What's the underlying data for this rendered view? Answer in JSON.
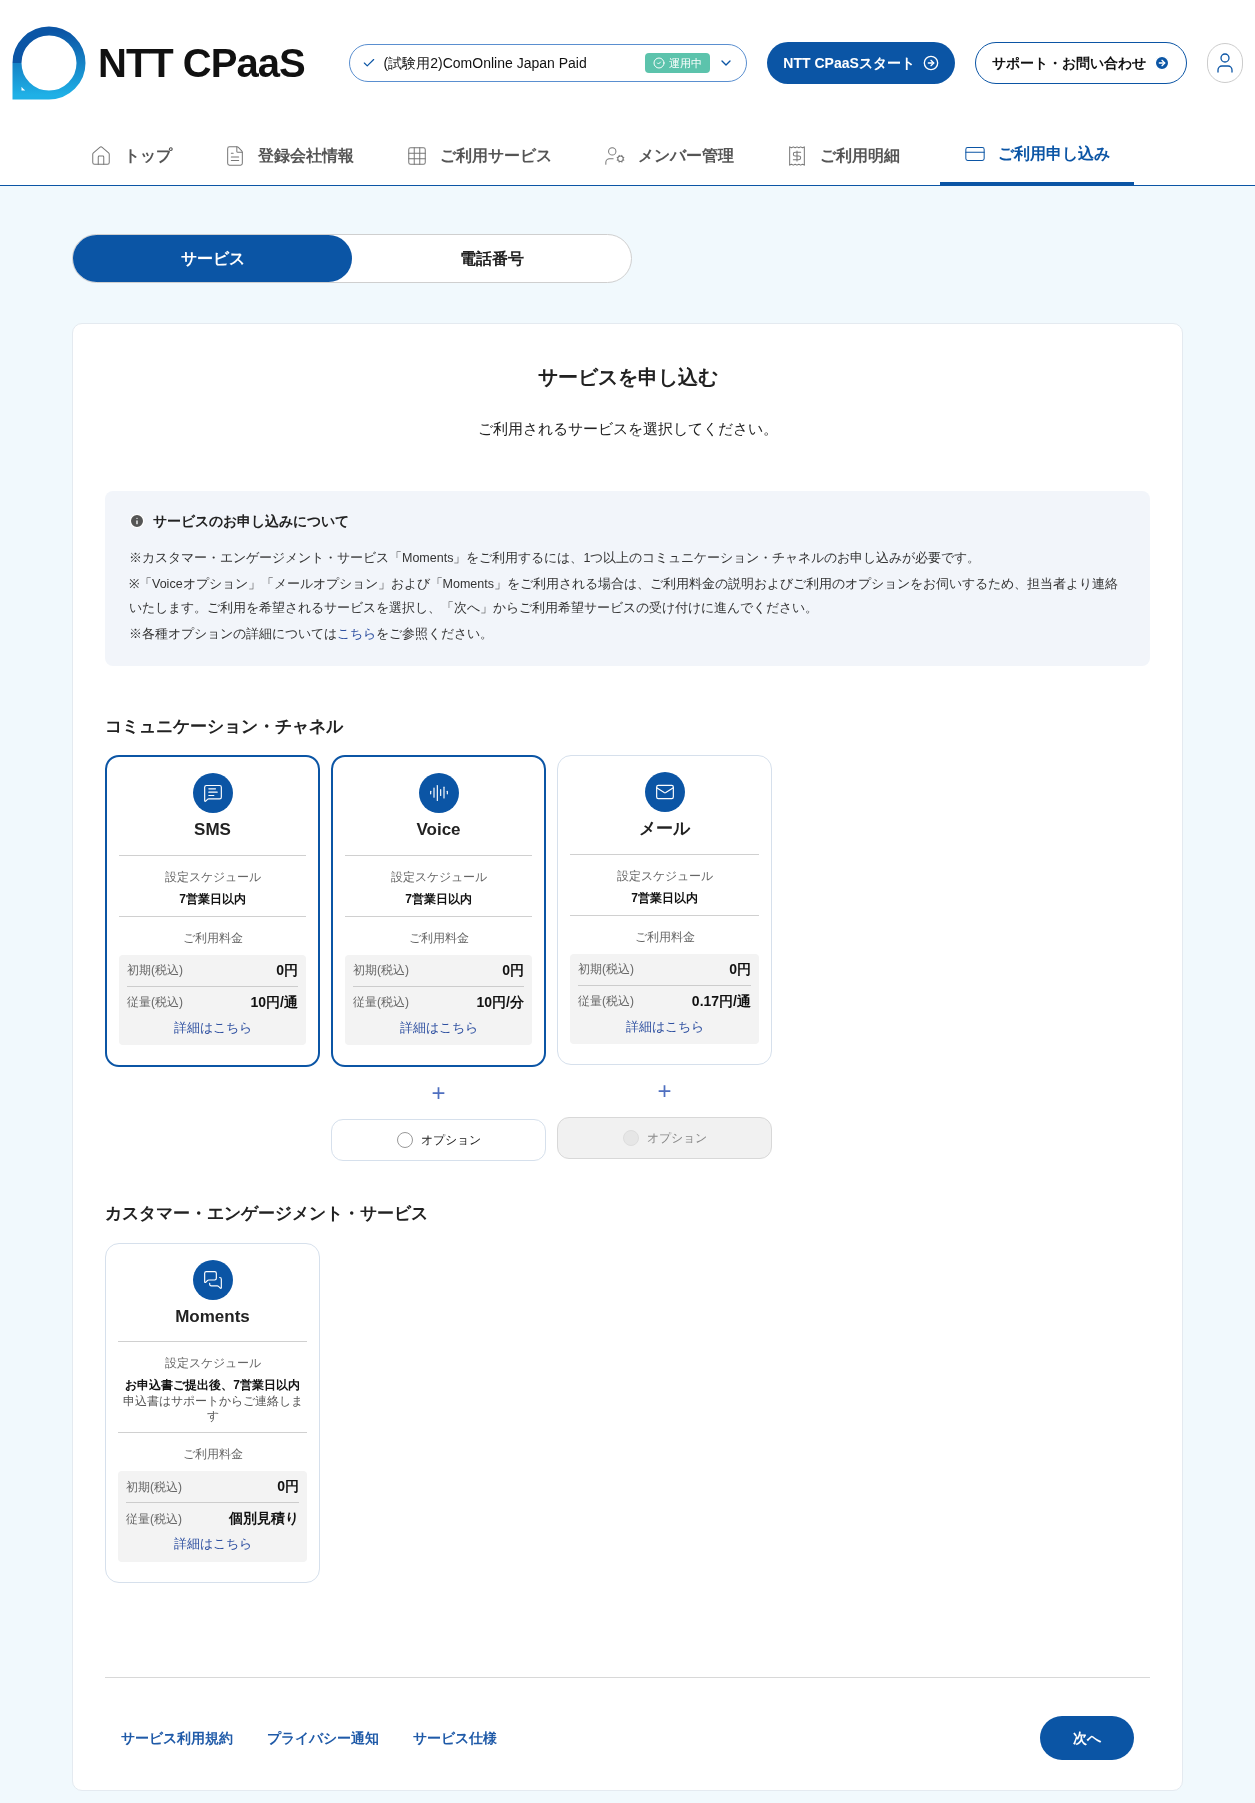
{
  "header": {
    "logo": "NTT CPaaS",
    "account": {
      "name": "(試験用2)ComOnline Japan Paid",
      "status": "運用中"
    },
    "buttons": [
      "NTT CPaaSスタート",
      "サポート・お問い合わせ"
    ]
  },
  "nav": [
    {
      "label": "トップ",
      "kind": "home",
      "selected": false
    },
    {
      "label": "登録会社情報",
      "kind": "doc",
      "selected": false
    },
    {
      "label": "ご利用サービス",
      "kind": "grid",
      "selected": false
    },
    {
      "label": "メンバー管理",
      "kind": "members",
      "selected": false
    },
    {
      "label": "ご利用明細",
      "kind": "bill",
      "selected": false
    },
    {
      "label": "ご利用申し込み",
      "kind": "apply",
      "selected": true
    }
  ],
  "tabs": [
    {
      "label": "サービス",
      "selected": true
    },
    {
      "label": "電話番号",
      "selected": false
    }
  ],
  "title": "サービスを申し込む",
  "subtitle": "ご利用されるサービスを選択してください。",
  "info": {
    "heading": "サービスのお申し込みについて",
    "notes": [
      "※カスタマー・エンゲージメント・サービス「Moments」をご利用するには、1つ以上のコミュニケーション・チャネルのお申し込みが必要です。",
      "※「Voiceオプション」「メールオプション」および「Moments」をご利用される場合は、ご利用料金の説明およびご利用のオプションをお伺いするため、担当者より連絡いたします。ご利用を希望されるサービスを選択し、「次へ」からご利用希望サービスの受け付けに進んでください。"
    ],
    "last_note": {
      "before": "※各種オプションの詳細については",
      "link": "こちら",
      "after": "をご参照ください。"
    }
  },
  "sections": [
    {
      "heading": "コミュニケーション・チャネル",
      "cards": [
        {
          "name": "SMS",
          "kind": "sms",
          "selected": true,
          "schedule_label": "設定スケジュール",
          "schedule": "7営業日以内",
          "fee_label": "ご利用料金",
          "rows": [
            {
              "label": "初期(税込)",
              "value": "0円"
            },
            {
              "label": "従量(税込)",
              "value": "10円/通"
            }
          ],
          "link": "詳細はこちら"
        },
        {
          "name": "Voice",
          "kind": "voice",
          "selected": true,
          "schedule_label": "設定スケジュール",
          "schedule": "7営業日以内",
          "fee_label": "ご利用料金",
          "rows": [
            {
              "label": "初期(税込)",
              "value": "0円"
            },
            {
              "label": "従量(税込)",
              "value": "10円/分"
            }
          ],
          "link": "詳細はこちら",
          "option": {
            "plus": "+",
            "label": "オプション",
            "checked": false,
            "disabled": false
          }
        },
        {
          "name": "メール",
          "kind": "mail",
          "selected": false,
          "schedule_label": "設定スケジュール",
          "schedule": "7営業日以内",
          "fee_label": "ご利用料金",
          "rows": [
            {
              "label": "初期(税込)",
              "value": "0円"
            },
            {
              "label": "従量(税込)",
              "value": "0.17円/通"
            }
          ],
          "link": "詳細はこちら",
          "option": {
            "plus": "+",
            "label": "オプション",
            "checked": false,
            "disabled": true
          }
        }
      ]
    },
    {
      "heading": "カスタマー・エンゲージメント・サービス",
      "cards": [
        {
          "name": "Moments",
          "kind": "moments",
          "selected": false,
          "schedule_label": "設定スケジュール",
          "schedule": "お申込書ご提出後、7営業日以内",
          "schedule_note": "申込書はサポートからご連絡します",
          "fee_label": "ご利用料金",
          "rows": [
            {
              "label": "初期(税込)",
              "value": "0円"
            },
            {
              "label": "従量(税込)",
              "value": "個別見積り"
            }
          ],
          "link": "詳細はこちら"
        }
      ]
    }
  ],
  "footer": {
    "links": [
      "サービス利用規約",
      "プライバシー通知",
      "サービス仕様"
    ],
    "next": "次へ"
  }
}
